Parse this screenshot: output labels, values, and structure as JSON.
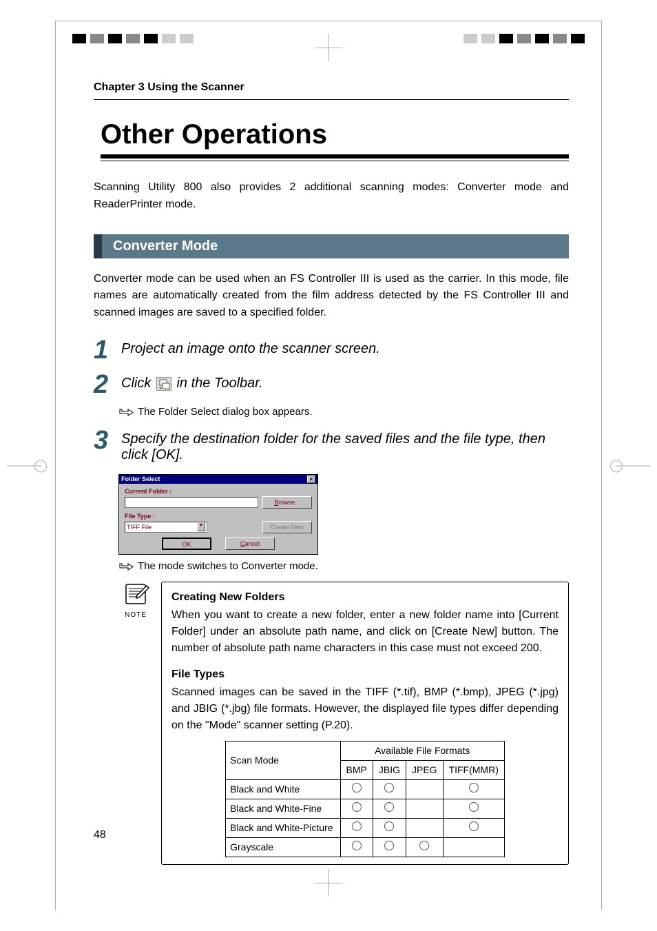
{
  "page": {
    "number": "48",
    "chapter_header": "Chapter 3 Using the Scanner",
    "title": "Other Operations",
    "intro": "Scanning Utility 800 also provides 2 additional scanning modes: Converter mode and ReaderPrinter mode."
  },
  "section": {
    "heading": "Converter Mode",
    "body": "Converter mode can be used when an FS Controller III is used as the carrier. In this mode, file names are automatically created from the film address detected by the FS Controller III and scanned images are saved to a specified folder."
  },
  "steps": {
    "s1": {
      "num": "1",
      "title": "Project an image onto the scanner screen."
    },
    "s2": {
      "num": "2",
      "title_before": "Click ",
      "title_after": " in the Toolbar.",
      "sub": "The Folder Select dialog box appears."
    },
    "s3": {
      "num": "3",
      "title": "Specify the destination folder for the saved files and the file type, then click [OK].",
      "sub": "The mode switches to Converter mode."
    }
  },
  "dialog": {
    "title": "Folder Select",
    "current_folder_label": "Current Folder :",
    "file_type_label": "File Type :",
    "file_type_value": "TIFF File",
    "browse": "Browse...",
    "create_new": "Create New",
    "ok": "OK",
    "cancel": "Cancel"
  },
  "note": {
    "label": "NOTE",
    "h1": "Creating New Folders",
    "p1": "When you want to create a new folder, enter a new folder name into [Current Folder] under an absolute path name, and click on [Create New] button.  The number of absolute path name characters in this case must not exceed 200.",
    "h2": "File Types",
    "p2": "Scanned images can be saved in the TIFF (*.tif), BMP (*.bmp), JPEG (*.jpg) and JBIG (*.jbg) file formats. However, the displayed file types differ depending on the \"Mode\" scanner setting (P.20)."
  },
  "table": {
    "scan_mode": "Scan Mode",
    "available": "Available File Formats",
    "cols": {
      "bmp": "BMP",
      "jbig": "JBIG",
      "jpeg": "JPEG",
      "tiff": "TIFF(MMR)"
    },
    "rows": {
      "r1": "Black and White",
      "r2": "Black and White-Fine",
      "r3": "Black and White-Picture",
      "r4": "Grayscale"
    }
  }
}
